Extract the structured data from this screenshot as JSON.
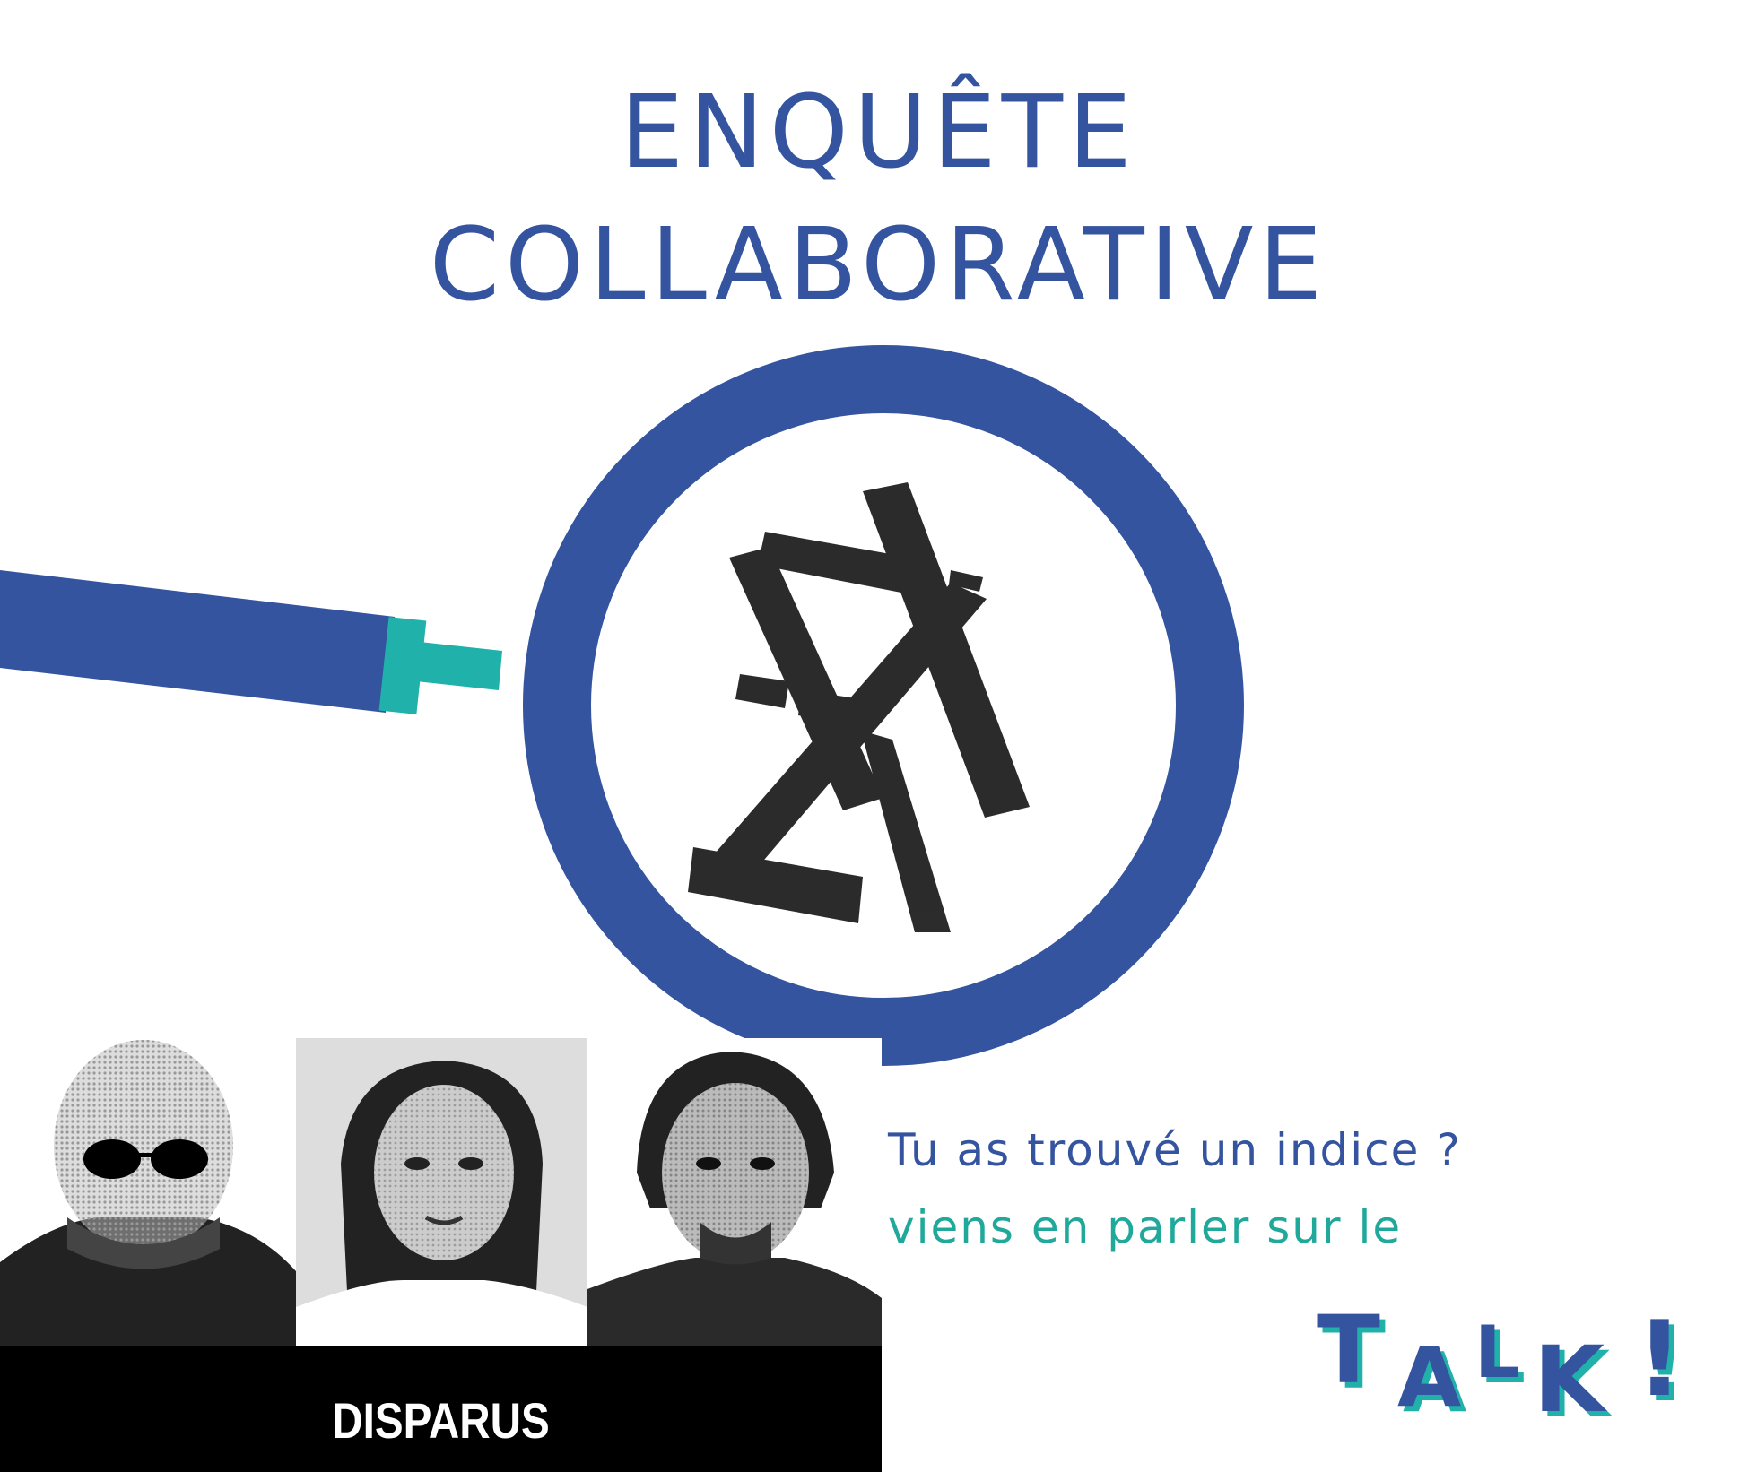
{
  "title": {
    "line1": "ENQUÊTE",
    "line2": "COLLABORATIVE"
  },
  "tagline": {
    "line1": "Tu as trouvé un indice ?",
    "line2": "viens en parler sur le"
  },
  "talk": {
    "letters": [
      "T",
      "A",
      "L",
      "K",
      "!"
    ]
  },
  "caption": "DISPARUS",
  "colors": {
    "blue": "#3454a0",
    "teal": "#20b2aa",
    "text_teal": "#20a89a",
    "black": "#111111"
  },
  "icons": [
    "magnifier-icon",
    "ink-glyph-icon"
  ]
}
